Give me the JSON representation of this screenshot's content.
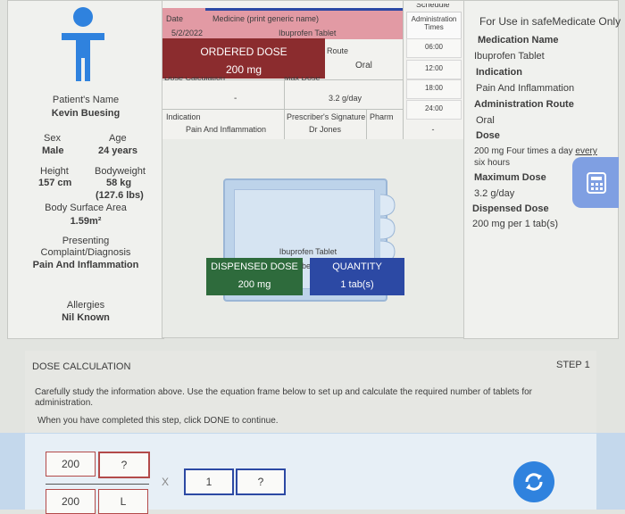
{
  "patient": {
    "name_label": "Patient's Name",
    "name": "Kevin Buesing",
    "sex_label": "Sex",
    "sex": "Male",
    "age_label": "Age",
    "age": "24 years",
    "height_label": "Height",
    "height": "157 cm",
    "bodyweight_label": "Bodyweight",
    "bodyweight": "58 kg",
    "bodyweight_lbs": "(127.6 lbs)",
    "bsa_label": "Body Surface Area",
    "bsa": "1.59m²",
    "complaint_label_1": "Presenting",
    "complaint_label_2": "Complaint/Diagnosis",
    "complaint": "Pain And Inflammation",
    "allergies_label": "Allergies",
    "allergies": "Nil Known"
  },
  "chart": {
    "date_label": "Date",
    "date": "5/2/2022",
    "medicine_label": "Medicine (print generic name)",
    "medicine": "Ibuprofen Tablet",
    "ordered_dose_label": "ORDERED DOSE",
    "ordered_dose": "200 mg",
    "route_label": "Route",
    "route": "Oral",
    "dose_calc_label": "Dose Calculation",
    "max_dose_label": "Max Dose",
    "dose_dash": "-",
    "max_dose": "3.2 g/day",
    "indication_label": "Indication",
    "indication": "Pain And Inflammation",
    "prescriber_label": "Prescriber's Signature",
    "prescriber": "Dr Jones",
    "pharm_label": "Pharm",
    "admin_header_cut": "Schedule",
    "admin_times_label_1": "Administration",
    "admin_times_label_2": "Times",
    "times": [
      "06:00",
      "12:00",
      "18:00",
      "24:00"
    ],
    "time_dash": "-"
  },
  "drug_box": {
    "name": "Ibuprofen Tablet",
    "dispensed_label": "DISPENSED DOSE",
    "dispensed": "200 mg",
    "quantity_label": "QUANTITY",
    "quantity": "1 tab(s)",
    "hidden_fragment": "be"
  },
  "info": {
    "title": "For Use in safeMedicate Only",
    "med_name_label": "Medication Name",
    "med_name": "Ibuprofen Tablet",
    "indication_label": "Indication",
    "indication": "Pain And Inflammation",
    "route_label": "Administration Route",
    "route": "Oral",
    "dose_label": "Dose",
    "dose_1": "200 mg Four times a day",
    "dose_link": "every",
    "dose_2": "six hours",
    "max_label": "Maximum Dose",
    "max": "3.2 g/day",
    "dispensed_label": "Dispensed Dose",
    "dispensed": "200 mg per 1 tab(s)"
  },
  "step": {
    "title": "DOSE CALCULATION",
    "step_label": "STEP 1",
    "instruction": "Carefully study the information above. Use the equation frame below to set up and calculate the required number of tablets for administration.",
    "instruction_2": "When you have completed this step, click DONE to continue."
  },
  "equation": {
    "num_left": "200",
    "num_right": "?",
    "den_left": "200",
    "den_right": "L",
    "times": "X",
    "mult_left": "1",
    "mult_right": "?"
  },
  "colors": {
    "header_pink": "#e29aa4",
    "ordered_red": "#8b2c2e",
    "dispensed_green": "#2e6b3c",
    "quantity_blue": "#2c49a4",
    "calculator_blue": "#7f9fe2",
    "work_area_blue": "#c4d8ec"
  }
}
